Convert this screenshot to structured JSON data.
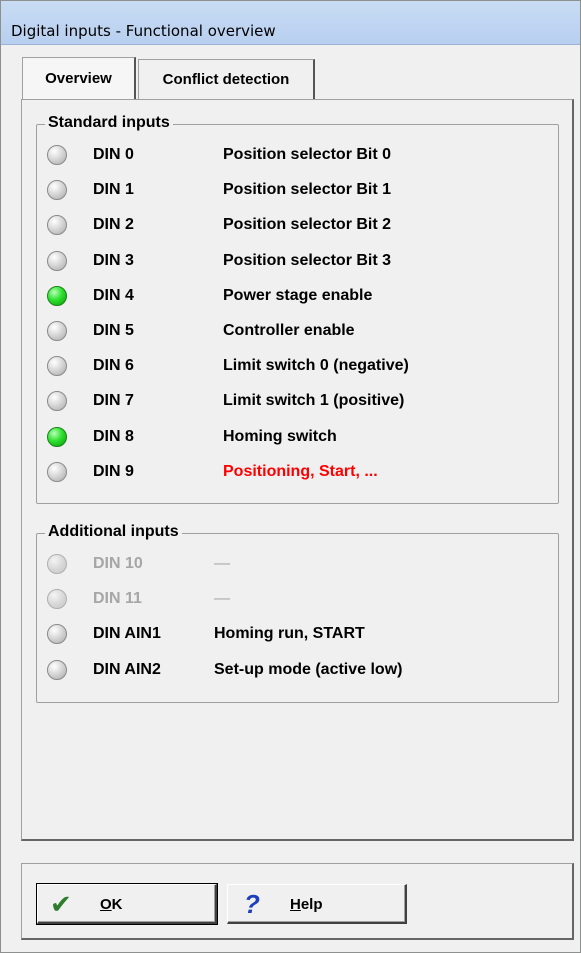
{
  "window": {
    "title": "Digital inputs - Functional overview"
  },
  "tabs": [
    {
      "label": "Overview",
      "active": true
    },
    {
      "label": "Conflict detection",
      "active": false
    }
  ],
  "standard": {
    "title": "Standard inputs",
    "rows": [
      {
        "din": "DIN 0",
        "func": "Position selector Bit 0",
        "state": "off"
      },
      {
        "din": "DIN 1",
        "func": "Position selector Bit 1",
        "state": "off"
      },
      {
        "din": "DIN 2",
        "func": "Position selector Bit 2",
        "state": "off"
      },
      {
        "din": "DIN 3",
        "func": "Position selector Bit 3",
        "state": "off"
      },
      {
        "din": "DIN 4",
        "func": "Power stage enable",
        "state": "on"
      },
      {
        "din": "DIN 5",
        "func": "Controller enable",
        "state": "off"
      },
      {
        "din": "DIN 6",
        "func": "Limit switch 0 (negative)",
        "state": "off"
      },
      {
        "din": "DIN 7",
        "func": "Limit switch 1 (positive)",
        "state": "off"
      },
      {
        "din": "DIN 8",
        "func": "Homing switch",
        "state": "on"
      },
      {
        "din": "DIN 9",
        "func": "Positioning, Start, ...",
        "state": "off",
        "highlight": "#ff0000"
      }
    ]
  },
  "additional": {
    "title": "Additional inputs",
    "rows": [
      {
        "din": "DIN 10",
        "func": "—",
        "state": "disabled"
      },
      {
        "din": "DIN 11",
        "func": "—",
        "state": "disabled"
      },
      {
        "din": "DIN AIN1",
        "func": "Homing run, START",
        "state": "off"
      },
      {
        "din": "DIN AIN2",
        "func": "Set-up mode (active low)",
        "state": "off"
      }
    ]
  },
  "buttons": {
    "ok": {
      "mnemonic": "O",
      "rest": "K",
      "icon": "checkmark-icon",
      "icon_color": "#2d7d2d"
    },
    "help": {
      "mnemonic": "H",
      "rest": "elp",
      "icon": "question-icon",
      "icon_color": "#1d3fbf"
    }
  },
  "colors": {
    "led_on": "#2ee02e",
    "led_off": "#c8c8c8",
    "warning_text": "#ff0000"
  }
}
